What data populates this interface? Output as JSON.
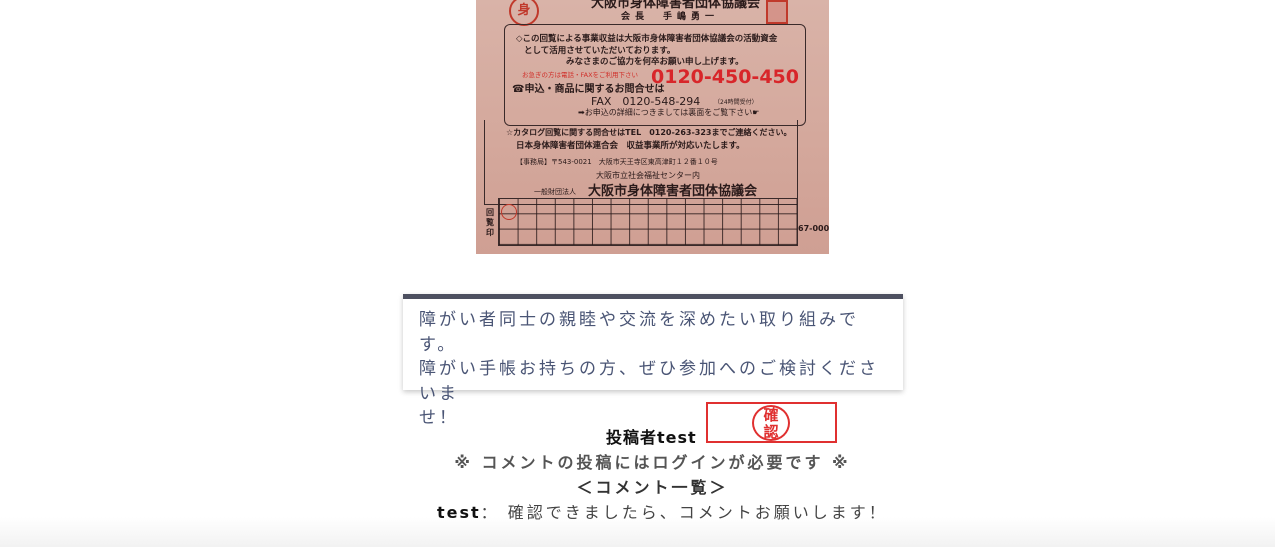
{
  "document_image": {
    "stamp_char": "身",
    "org_top": "大阪市身体障害者団体協議会",
    "chair": "会長　手嶋勇一",
    "line1": "◇この回覧による事業収益は大阪市身体障害者団体協議会の活動資金",
    "line2": "として活用させていただいております。",
    "line3": "みなさまのご協力を何卒お願い申し上げます。",
    "red_note": "お急ぎの方は電話・FAXをご利用下さい",
    "order_label": "☎申込・商品に関するお問合せは",
    "phone": "0120-450-450",
    "fax": "FAX　0120-548-294",
    "fax_note": "（24時間受付）",
    "detail": "➡お申込の詳細につきましては裏面をご覧下さい☛",
    "catalog": "☆カタログ回覧に関する問合せはTEL　0120-263-323までご連絡ください。",
    "catalog2": "日本身体障害者団体連合会　収益事業所が対応いたします。",
    "office": "【事務局】〒543-0021　大阪市天王寺区東高津町１２番１０号",
    "office2": "大阪市立社会福祉センター内",
    "assoc_small": "一般財団法人",
    "assoc": "大阪市身体障害者団体協議会",
    "grid_label": "回覧印",
    "code": "67-000"
  },
  "message": {
    "line1": "障がい者同士の親睦や交流を深めたい取り組みです。",
    "line2": "障がい手帳お持ちの方、ぜひ参加へのご検討くださいま",
    "line3": "せ！"
  },
  "poster": {
    "label": "投稿者test",
    "stamp_text": "確\n認"
  },
  "comments": {
    "login_notice": "※ コメントの投稿にはログインが必要です ※",
    "list_header": "＜コメント一覧＞",
    "items": [
      {
        "author": "test",
        "separator": "：",
        "text": "確認できましたら、コメントお願いします！"
      }
    ]
  },
  "colors": {
    "card_border": "#4d5060",
    "card_text": "#4a5575",
    "stamp_red": "#e03030",
    "phone_red": "#d8262a"
  }
}
